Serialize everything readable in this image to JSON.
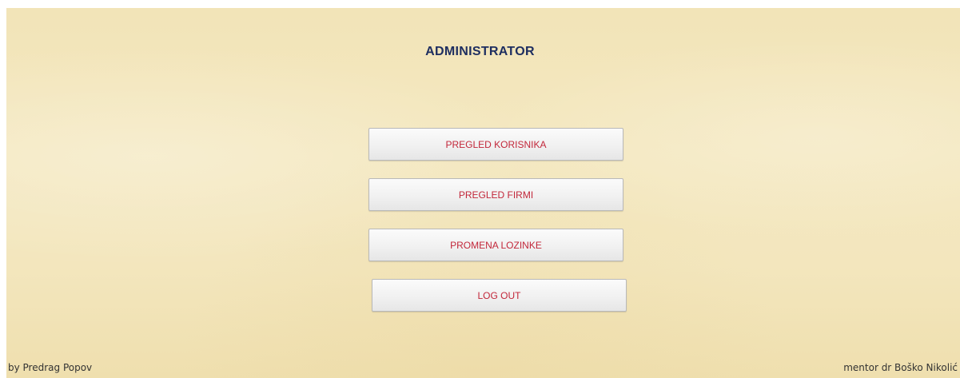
{
  "header": {
    "title": "ADMINISTRATOR"
  },
  "menu": {
    "items": [
      {
        "label": "PREGLED KORISNIKA"
      },
      {
        "label": "PREGLED FIRMI"
      },
      {
        "label": "PROMENA LOZINKE"
      },
      {
        "label": "LOG OUT"
      }
    ]
  },
  "footer": {
    "author": "by Predrag Popov",
    "mentor": "mentor dr Boško Nikolić"
  },
  "colors": {
    "title": "#1e2e60",
    "button_text": "#c2273a",
    "background": "#f3e6bd"
  }
}
